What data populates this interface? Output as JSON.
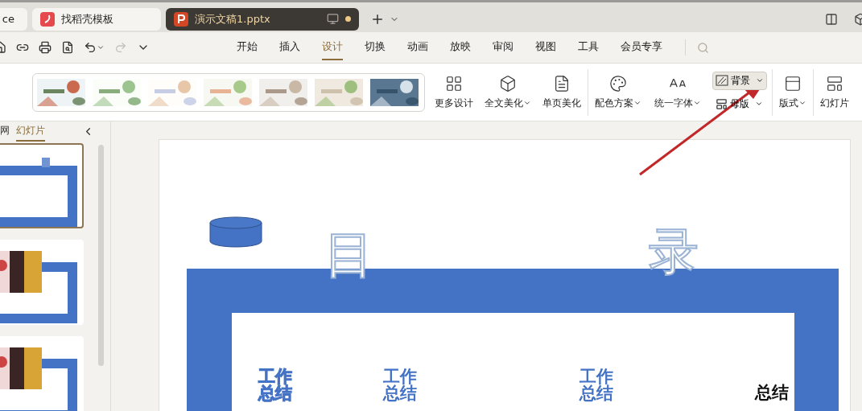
{
  "tabs": [
    {
      "label": "ce",
      "selected": false,
      "kind": "plain",
      "unsaved": false
    },
    {
      "label": "找稻壳模板",
      "selected": false,
      "kind": "docer",
      "unsaved": false
    },
    {
      "label": "演示文稿1.pptx",
      "selected": true,
      "kind": "pptx",
      "unsaved": true
    }
  ],
  "quick_access": {
    "redo_disabled": true
  },
  "menu": [
    {
      "label": "开始",
      "selected": false
    },
    {
      "label": "插入",
      "selected": false
    },
    {
      "label": "设计",
      "selected": true
    },
    {
      "label": "切换",
      "selected": false
    },
    {
      "label": "动画",
      "selected": false
    },
    {
      "label": "放映",
      "selected": false
    },
    {
      "label": "审阅",
      "selected": false
    },
    {
      "label": "视图",
      "selected": false
    },
    {
      "label": "工具",
      "selected": false
    },
    {
      "label": "会员专享",
      "selected": false
    }
  ],
  "ribbon": {
    "groups": [
      {
        "buttons": [
          {
            "kind": "large",
            "label": "更多设计",
            "dropdown": false,
            "highlighted": false
          },
          {
            "kind": "large",
            "label": "全文美化",
            "dropdown": true,
            "highlighted": false
          },
          {
            "kind": "large",
            "label": "单页美化",
            "dropdown": false,
            "highlighted": false
          }
        ]
      },
      {
        "buttons": [
          {
            "kind": "large",
            "label": "配色方案",
            "dropdown": true,
            "highlighted": false
          },
          {
            "kind": "large",
            "label": "统一字体",
            "dropdown": true,
            "highlighted": false
          },
          {
            "kind": "small",
            "label": "背景",
            "dropdown": true,
            "highlighted": true
          },
          {
            "kind": "small",
            "label": "母版",
            "dropdown": true,
            "highlighted": false
          }
        ]
      },
      {
        "buttons": [
          {
            "kind": "large",
            "label": "版式",
            "dropdown": true,
            "highlighted": false
          }
        ]
      },
      {
        "buttons": [
          {
            "kind": "large",
            "label": "幻灯片",
            "dropdown": false,
            "highlighted": false
          }
        ]
      }
    ]
  },
  "left_panel": {
    "tabs": [
      {
        "label": "网",
        "selected": false
      },
      {
        "label": "幻灯片",
        "selected": true
      }
    ],
    "slides": [
      {
        "kind": "contents",
        "selected": true
      },
      {
        "kind": "photos",
        "selected": false
      },
      {
        "kind": "photos",
        "selected": false
      }
    ]
  },
  "slide": {
    "title": [
      "目",
      "录"
    ],
    "items": [
      {
        "lines": [
          "工作",
          "总结"
        ],
        "kind": "outlined"
      },
      {
        "lines": [
          "工作",
          "总结"
        ],
        "kind": "solid"
      },
      {
        "lines": [
          "工作",
          "总结"
        ],
        "kind": "solid"
      },
      {
        "lines": [
          "总结"
        ],
        "kind": "dark"
      }
    ]
  }
}
